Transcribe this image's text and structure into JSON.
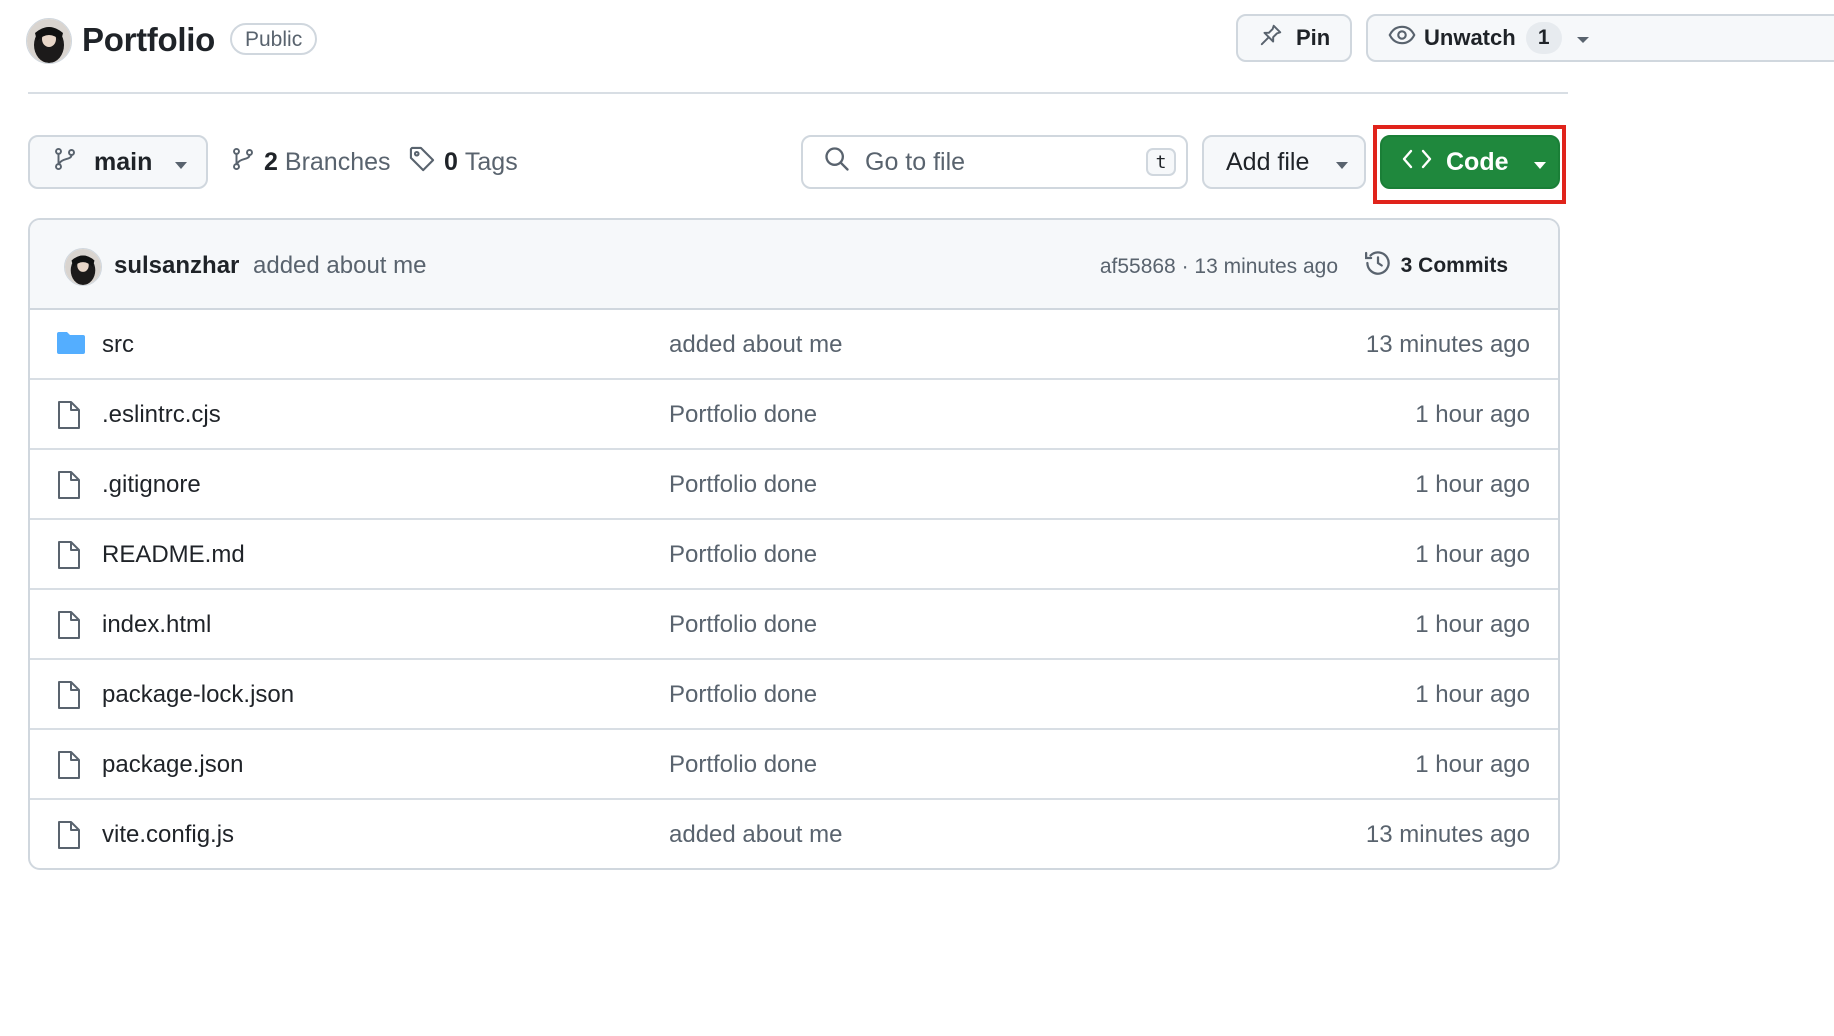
{
  "repo": {
    "name": "Portfolio",
    "visibility": "Public"
  },
  "header_actions": {
    "pin_label": "Pin",
    "watch_label": "Unwatch",
    "watch_count": "1"
  },
  "toolbar": {
    "branch": "main",
    "branches_count": "2",
    "branches_label": "Branches",
    "tags_count": "0",
    "tags_label": "Tags",
    "search_placeholder": "Go to file",
    "search_shortcut": "t",
    "add_file_label": "Add file",
    "code_label": "Code"
  },
  "latest_commit": {
    "author": "sulsanzhar",
    "message": "added about me",
    "meta": "af55868 · 13 minutes ago",
    "commits_label": "3 Commits"
  },
  "files": [
    {
      "name": "src",
      "type": "folder",
      "message": "added about me",
      "age": "13 minutes ago"
    },
    {
      "name": ".eslintrc.cjs",
      "type": "file",
      "message": "Portfolio done",
      "age": "1 hour ago"
    },
    {
      "name": ".gitignore",
      "type": "file",
      "message": "Portfolio done",
      "age": "1 hour ago"
    },
    {
      "name": "README.md",
      "type": "file",
      "message": "Portfolio done",
      "age": "1 hour ago"
    },
    {
      "name": "index.html",
      "type": "file",
      "message": "Portfolio done",
      "age": "1 hour ago"
    },
    {
      "name": "package-lock.json",
      "type": "file",
      "message": "Portfolio done",
      "age": "1 hour ago"
    },
    {
      "name": "package.json",
      "type": "file",
      "message": "Portfolio done",
      "age": "1 hour ago"
    },
    {
      "name": "vite.config.js",
      "type": "file",
      "message": "added about me",
      "age": "13 minutes ago"
    }
  ],
  "colors": {
    "code_button": "#1f883d",
    "highlight": "#e0231b",
    "folder_icon": "#54aeff"
  }
}
